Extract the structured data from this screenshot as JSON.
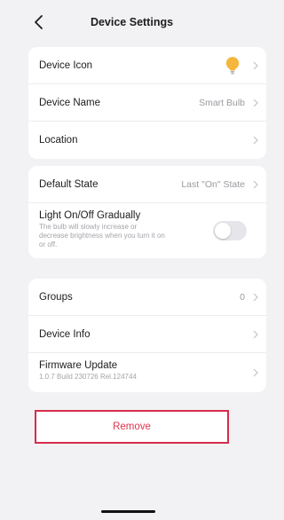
{
  "header": {
    "title": "Device Settings",
    "back_icon": "chevron-left-icon"
  },
  "group1": {
    "device_icon_label": "Device Icon",
    "bulb_icon": "light-bulb-icon",
    "bulb_color": "#f5b63f",
    "device_name_label": "Device Name",
    "device_name_value": "Smart Bulb",
    "location_label": "Location"
  },
  "group2": {
    "default_state_label": "Default State",
    "default_state_value": "Last \"On\" State",
    "gradual_label": "Light On/Off Gradually",
    "gradual_desc_1": "The bulb will slowly increase or",
    "gradual_desc_2": "decrease brightness when you turn it on",
    "gradual_desc_3": "or off.",
    "gradual_enabled": false
  },
  "group3": {
    "groups_label": "Groups",
    "groups_value": "0",
    "device_info_label": "Device Info",
    "firmware_label": "Firmware Update",
    "firmware_value": "1.0.7 Build 230726 Rel.124744"
  },
  "remove_label": "Remove",
  "colors": {
    "danger": "#d62d4b",
    "background": "#f2f2f4"
  }
}
